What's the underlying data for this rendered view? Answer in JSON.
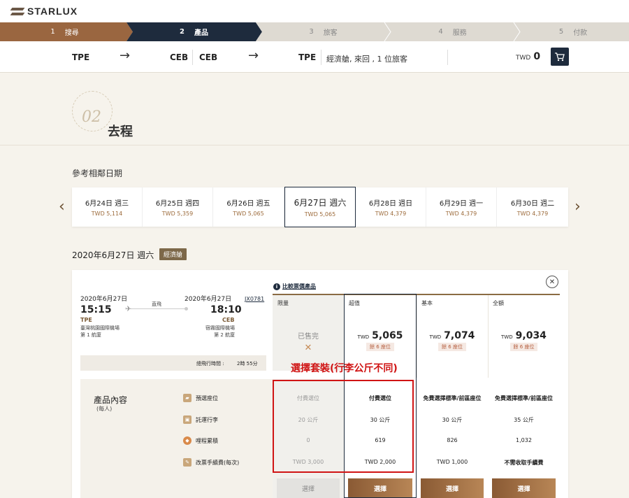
{
  "brand": {
    "name": "STARLUX"
  },
  "steps": [
    {
      "num": "1",
      "label": "搜尋"
    },
    {
      "num": "2",
      "label": "產品"
    },
    {
      "num": "3",
      "label": "旅客"
    },
    {
      "num": "4",
      "label": "服務"
    },
    {
      "num": "5",
      "label": "付款"
    }
  ],
  "route": {
    "seg1_from": "TPE",
    "seg1_to": "CEB",
    "seg2_from": "CEB",
    "seg2_to": "TPE",
    "arrow": "→",
    "info": "經濟艙, 來回 , 1 位旅客",
    "total_currency": "TWD",
    "total_value": "0"
  },
  "header": {
    "step_number": "02",
    "title": "去程"
  },
  "dates_section": {
    "title": "參考相鄰日期",
    "prev": "‹",
    "next": "›"
  },
  "dates": [
    {
      "date": "6月24日 週三",
      "price": "TWD 5,114"
    },
    {
      "date": "6月25日 週四",
      "price": "TWD 5,359"
    },
    {
      "date": "6月26日 週五",
      "price": "TWD 5,065"
    },
    {
      "date": "6月27日 週六",
      "price": "TWD 5,065"
    },
    {
      "date": "6月28日 週日",
      "price": "TWD 4,379"
    },
    {
      "date": "6月29日 週一",
      "price": "TWD 4,379"
    },
    {
      "date": "6月30日 週二",
      "price": "TWD 4,379"
    }
  ],
  "flight_header": {
    "date": "2020年6月27日 週六",
    "cabin": "經濟艙"
  },
  "flight": {
    "compare_link": "比較票價產品",
    "dep_date": "2020年6月27日",
    "dep_time": "15:15",
    "dep_code": "TPE",
    "dep_airport": "臺灣桃園國際機場",
    "dep_terminal": "第 1 航廈",
    "direct": "直飛",
    "arr_date": "2020年6月27日",
    "arr_time": "18:10",
    "arr_code": "CEB",
    "arr_airport": "宿霧國際機場",
    "arr_terminal": "第 2 航廈",
    "flight_no": "JX0781",
    "duration_label": "總飛行時間 :",
    "duration": "2時 55分"
  },
  "fares": [
    {
      "name": "限量",
      "sold_out": "已售完",
      "sold_mark": "✕"
    },
    {
      "name": "超值",
      "currency": "TWD",
      "price": "5,065",
      "seats": "餘 6 座位"
    },
    {
      "name": "基本",
      "currency": "TWD",
      "price": "7,074",
      "seats": "餘 6 座位"
    },
    {
      "name": "全額",
      "currency": "TWD",
      "price": "9,034",
      "seats": "餘 6 座位"
    }
  ],
  "annotation": "選擇套裝(行李公斤不同)",
  "product": {
    "title": "產品內容",
    "subtitle": "(每人)",
    "features": [
      {
        "label": "預選座位",
        "icon": "seat-icon"
      },
      {
        "label": "託運行李",
        "icon": "baggage-icon"
      },
      {
        "label": "哩程累積",
        "icon": "miles-icon"
      },
      {
        "label": "改票手續費(每次)",
        "icon": "change-fee-icon"
      }
    ],
    "rows": [
      [
        "付費選位",
        "付費選位",
        "免費選擇標準/前區座位",
        "免費選擇標準/前區座位"
      ],
      [
        "20 公斤",
        "30 公斤",
        "30 公斤",
        "35 公斤"
      ],
      [
        "0",
        "619",
        "826",
        "1,032"
      ],
      [
        "TWD 3,000",
        "TWD 2,000",
        "TWD 1,000",
        "不需收取手續費"
      ]
    ],
    "select_label": "選擇"
  },
  "colors": {
    "brand_brown": "#6b5032",
    "navy": "#1e2b3d",
    "highlight_red": "#d01414",
    "background": "#f6f3ec"
  }
}
